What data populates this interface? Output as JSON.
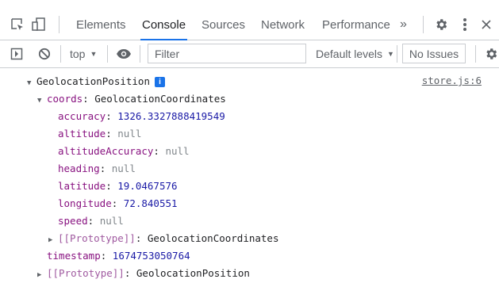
{
  "tabs": [
    {
      "label": "Elements"
    },
    {
      "label": "Console"
    },
    {
      "label": "Sources"
    },
    {
      "label": "Network"
    },
    {
      "label": "Performance"
    }
  ],
  "more_tabs_glyph": "»",
  "toolbar": {
    "context": "top",
    "filter_placeholder": "Filter",
    "levels": "Default levels",
    "issues": "No Issues"
  },
  "accent_color": "#1a73e8",
  "console": {
    "source_link": "store.js:6",
    "root_label": "GeolocationPosition",
    "info_badge": "i",
    "coords_key": "coords",
    "coords_type": "GeolocationCoordinates",
    "props": [
      {
        "key": "accuracy",
        "value": "1326.3327888419549",
        "kind": "number"
      },
      {
        "key": "altitude",
        "value": "null",
        "kind": "null"
      },
      {
        "key": "altitudeAccuracy",
        "value": "null",
        "kind": "null"
      },
      {
        "key": "heading",
        "value": "null",
        "kind": "null"
      },
      {
        "key": "latitude",
        "value": "19.0467576",
        "kind": "number"
      },
      {
        "key": "longitude",
        "value": "72.840551",
        "kind": "number"
      },
      {
        "key": "speed",
        "value": "null",
        "kind": "null"
      }
    ],
    "coords_proto_key": "[[Prototype]]",
    "coords_proto_value": "GeolocationCoordinates",
    "timestamp_key": "timestamp",
    "timestamp_value": "1674753050764",
    "root_proto_key": "[[Prototype]]",
    "root_proto_value": "GeolocationPosition"
  }
}
